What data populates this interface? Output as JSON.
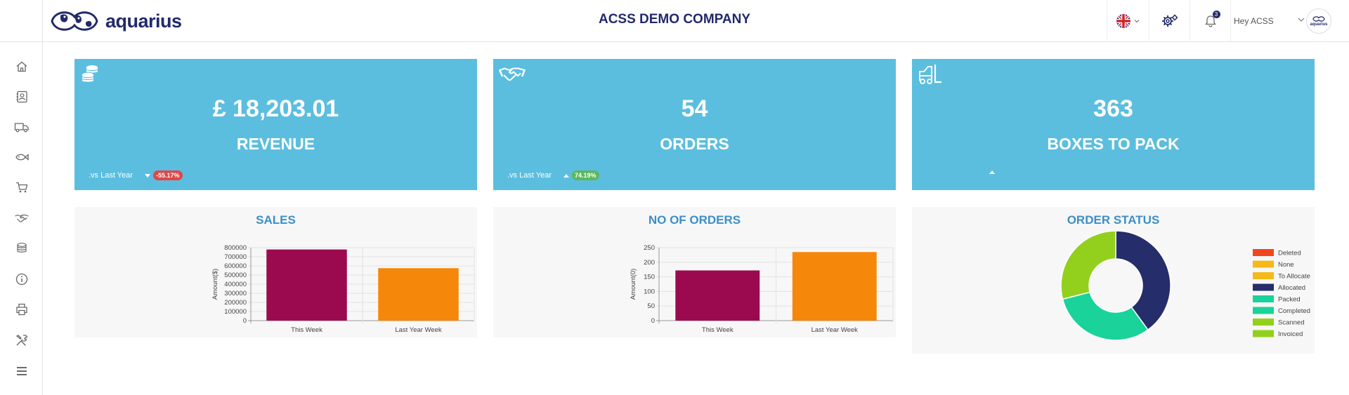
{
  "header": {
    "logo_text": "aquarius",
    "company": "ACSS DEMO COMPANY",
    "notification_count": "3",
    "user_greeting": "Hey ACSS",
    "avatar_text": "aquarius"
  },
  "sidebar": {
    "items": [
      {
        "icon": "home-icon"
      },
      {
        "icon": "contacts-icon"
      },
      {
        "icon": "truck-icon"
      },
      {
        "icon": "fish-icon"
      },
      {
        "icon": "cart-icon"
      },
      {
        "icon": "handshake-icon"
      },
      {
        "icon": "coins-icon"
      },
      {
        "icon": "info-icon"
      },
      {
        "icon": "printer-icon"
      },
      {
        "icon": "tools-icon"
      },
      {
        "icon": "menu-icon"
      }
    ]
  },
  "cards": [
    {
      "icon": "coins-icon",
      "value": "£ 18,203.01",
      "label": "REVENUE",
      "vs_text": ".vs Last Year",
      "change": "-55.17%",
      "trend": "down"
    },
    {
      "icon": "handshake-icon",
      "value": "54",
      "label": "ORDERS",
      "vs_text": ".vs Last Year",
      "change": "74.19%",
      "trend": "up"
    },
    {
      "icon": "forklift-icon",
      "value": "363",
      "label": "BOXES TO PACK",
      "vs_text": "",
      "change": "",
      "trend": "up"
    }
  ],
  "colors": {
    "card_bg": "#5bbedf",
    "brand_navy": "#222a6b",
    "panel_title": "#3b8fc9",
    "bar_this_week": "#9b0a4f",
    "bar_last_year": "#f5870a"
  },
  "chart_data": [
    {
      "type": "bar",
      "title": "SALES",
      "categories": [
        "This Week",
        "Last Year Week"
      ],
      "values": [
        780000,
        575000
      ],
      "ylabel": "Amount($)",
      "xlabel": "",
      "ylim": [
        0,
        800000
      ],
      "yticks": [
        "0",
        "100000",
        "200000",
        "300000",
        "400000",
        "500000",
        "600000",
        "700000",
        "800000"
      ],
      "grid": true,
      "colors": [
        "#9b0a4f",
        "#f5870a"
      ]
    },
    {
      "type": "bar",
      "title": "NO OF ORDERS",
      "categories": [
        "This Week",
        "Last Year Week"
      ],
      "values": [
        172,
        235
      ],
      "ylabel": "Amount(0)",
      "xlabel": "",
      "ylim": [
        0,
        250
      ],
      "yticks": [
        "0",
        "50",
        "100",
        "150",
        "200",
        "250"
      ],
      "grid": true,
      "colors": [
        "#9b0a4f",
        "#f5870a"
      ]
    },
    {
      "type": "pie",
      "title": "ORDER STATUS",
      "donut": true,
      "legend_position": "right",
      "labels": [
        "Deleted",
        "None",
        "To Allocate",
        "Allocated",
        "Packed",
        "Completed",
        "Scanned",
        "Invoiced"
      ],
      "colors": [
        "#f0471e",
        "#f4b91a",
        "#f4b91a",
        "#252d6b",
        "#19d39a",
        "#19d39a",
        "#93d01e",
        "#93d01e"
      ],
      "values": [
        0,
        0,
        0,
        40,
        0,
        31,
        0,
        29
      ]
    }
  ]
}
